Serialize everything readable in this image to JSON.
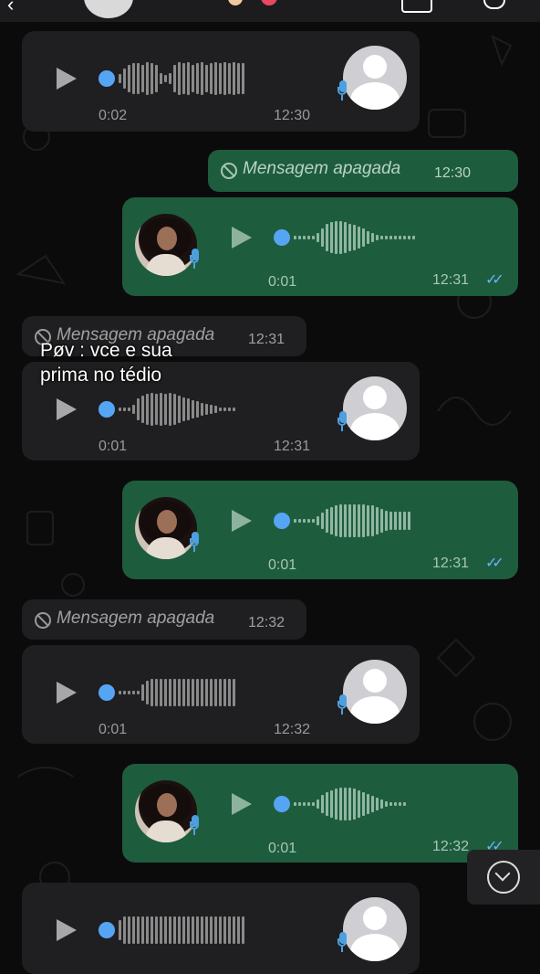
{
  "caption": "Pøv : vce e sua\nprima no tédio",
  "messages": [
    {
      "kind": "voice",
      "dir": "in",
      "duration": "0:02",
      "time": "12:30"
    },
    {
      "kind": "deleted",
      "dir": "out",
      "text": "Mensagem apagada",
      "time": "12:30"
    },
    {
      "kind": "voice",
      "dir": "out",
      "duration": "0:01",
      "time": "12:31",
      "read": true
    },
    {
      "kind": "deleted",
      "dir": "in",
      "text": "Mensagem apagada",
      "time": "12:31"
    },
    {
      "kind": "voice",
      "dir": "in",
      "duration": "0:01",
      "time": "12:31"
    },
    {
      "kind": "voice",
      "dir": "out",
      "duration": "0:01",
      "time": "12:31",
      "read": true
    },
    {
      "kind": "deleted",
      "dir": "in",
      "text": "Mensagem apagada",
      "time": "12:32"
    },
    {
      "kind": "voice",
      "dir": "in",
      "duration": "0:01",
      "time": "12:32"
    },
    {
      "kind": "voice",
      "dir": "out",
      "duration": "0:01",
      "time": "12:32",
      "read": true
    },
    {
      "kind": "voice",
      "dir": "in",
      "duration": "",
      "time": ""
    }
  ],
  "colors": {
    "incoming": "#1f1f21",
    "outgoing": "#1e5c3e",
    "accent": "#56a5f5",
    "background": "#0b0b0b"
  },
  "icons": [
    "play-icon",
    "mic-icon",
    "ban-icon",
    "double-check-icon",
    "chevron-down-icon",
    "avatar-placeholder-icon"
  ]
}
